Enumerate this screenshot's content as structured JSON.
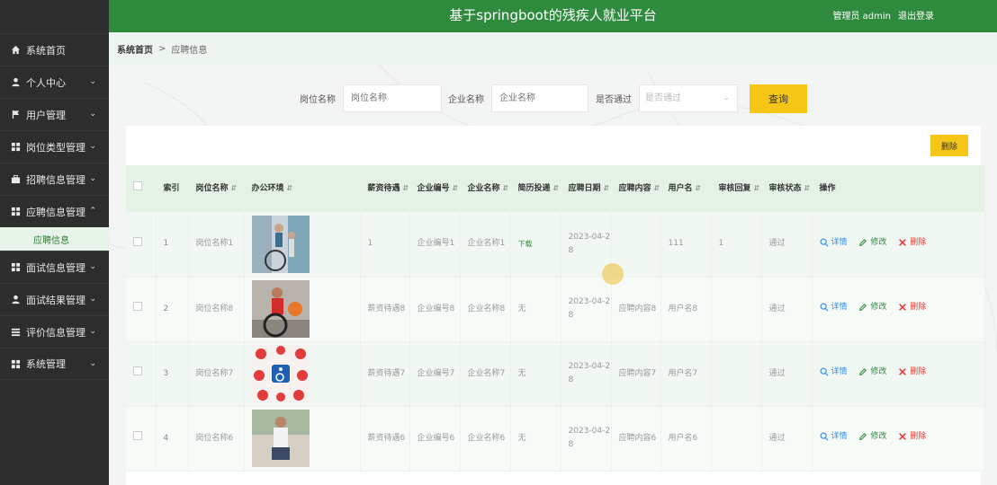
{
  "app": {
    "title": "基于springboot的残疾人就业平台",
    "user_label": "管理员 admin",
    "logout_label": "退出登录"
  },
  "sidebar": {
    "items": [
      {
        "label": "系统首页",
        "icon": "home-icon"
      },
      {
        "label": "个人中心",
        "icon": "user-icon",
        "chevron": "down"
      },
      {
        "label": "用户管理",
        "icon": "flag-icon",
        "chevron": "down"
      },
      {
        "label": "岗位类型管理",
        "icon": "grid-icon",
        "chevron": "down"
      },
      {
        "label": "招聘信息管理",
        "icon": "briefcase-icon",
        "chevron": "down"
      },
      {
        "label": "应聘信息管理",
        "icon": "grid-icon",
        "chevron": "up"
      },
      {
        "label": "面试信息管理",
        "icon": "grid-icon",
        "chevron": "down"
      },
      {
        "label": "面试结果管理",
        "icon": "user-icon",
        "chevron": "down"
      },
      {
        "label": "评价信息管理",
        "icon": "list-icon",
        "chevron": "down"
      },
      {
        "label": "系统管理",
        "icon": "grid-icon",
        "chevron": "down"
      }
    ],
    "active_sub": "应聘信息"
  },
  "breadcrumb": {
    "home": "系统首页",
    "separator": ">",
    "current": "应聘信息"
  },
  "search": {
    "job_label": "岗位名称",
    "job_placeholder": "岗位名称",
    "company_label": "企业名称",
    "company_placeholder": "企业名称",
    "passed_label": "是否通过",
    "passed_placeholder": "是否通过",
    "query_button": "查询"
  },
  "toolbar": {
    "delete_button": "删除"
  },
  "table": {
    "headers": [
      {
        "label": "索引",
        "sortable": false
      },
      {
        "label": "岗位名称",
        "sortable": true
      },
      {
        "label": "办公环境",
        "sortable": true
      },
      {
        "label": "薪资待遇",
        "sortable": true
      },
      {
        "label": "企业编号",
        "sortable": true
      },
      {
        "label": "企业名称",
        "sortable": true
      },
      {
        "label": "简历投递",
        "sortable": true
      },
      {
        "label": "应聘日期",
        "sortable": true
      },
      {
        "label": "应聘内容",
        "sortable": true
      },
      {
        "label": "用户名",
        "sortable": true
      },
      {
        "label": "审核回复",
        "sortable": true
      },
      {
        "label": "审核状态",
        "sortable": true
      },
      {
        "label": "操作",
        "sortable": false
      }
    ],
    "actions": {
      "detail": "详情",
      "edit": "修改",
      "delete": "删除"
    },
    "rows": [
      {
        "index": "1",
        "job": "岗位名称1",
        "env": "wheelchair-couple-photo",
        "salary": "1",
        "company_no": "企业编号1",
        "company_name": "企业名称1",
        "resume": "下载",
        "date": "2023-04-28",
        "content": "",
        "username": "111",
        "reply": "1",
        "status": "通过"
      },
      {
        "index": "2",
        "job": "岗位名称8",
        "env": "wheelchair-basketball-photo",
        "salary": "薪资待遇8",
        "company_no": "企业编号8",
        "company_name": "企业名称8",
        "resume": "无",
        "date": "2023-04-28",
        "content": "应聘内容8",
        "username": "用户名8",
        "reply": "",
        "status": "通过"
      },
      {
        "index": "3",
        "job": "岗位名称7",
        "env": "accessibility-hearts-photo",
        "salary": "薪资待遇7",
        "company_no": "企业编号7",
        "company_name": "企业名称7",
        "resume": "无",
        "date": "2023-04-28",
        "content": "应聘内容7",
        "username": "用户名7",
        "reply": "",
        "status": "通过"
      },
      {
        "index": "4",
        "job": "岗位名称6",
        "env": "seated-man-photo",
        "salary": "薪资待遇6",
        "company_no": "企业编号6",
        "company_name": "企业名称6",
        "resume": "无",
        "date": "2023-04-28",
        "content": "应聘内容6",
        "username": "用户名6",
        "reply": "",
        "status": "通过"
      }
    ]
  },
  "colors": {
    "brand_green": "#2e8b3e",
    "sidebar_bg": "#2d2d2d",
    "button_yellow": "#f5c518"
  }
}
